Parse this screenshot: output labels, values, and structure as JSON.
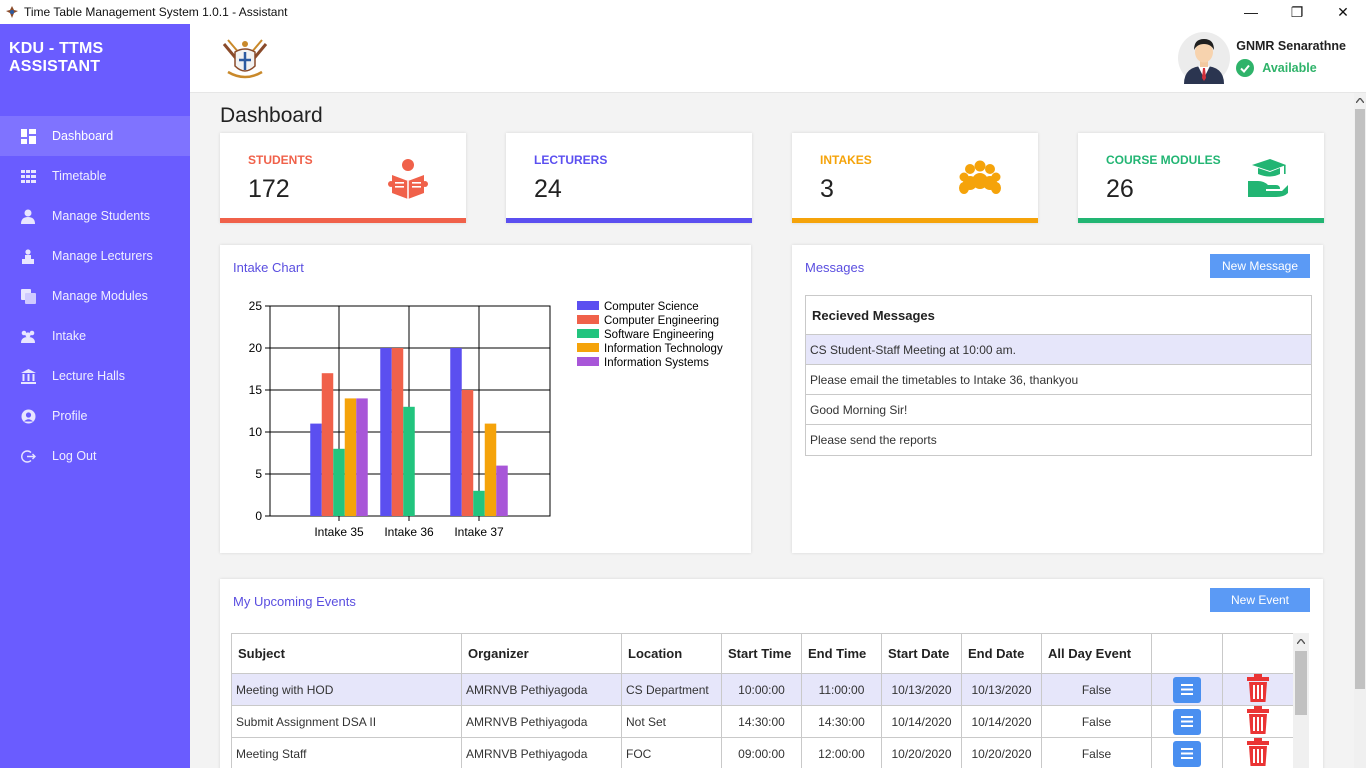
{
  "window": {
    "title": "Time Table Management System 1.0.1 - Assistant",
    "minimize": "—",
    "maximize": "❐",
    "close": "✕"
  },
  "sidebar": {
    "brand": "KDU - TTMS ASSISTANT",
    "items": [
      {
        "label": "Dashboard",
        "icon": "dashboard-icon",
        "active": true
      },
      {
        "label": "Timetable",
        "icon": "table-icon"
      },
      {
        "label": "Manage Students",
        "icon": "student-icon"
      },
      {
        "label": "Manage Lecturers",
        "icon": "lecturer-icon"
      },
      {
        "label": "Manage Modules",
        "icon": "modules-icon"
      },
      {
        "label": "Intake",
        "icon": "group-icon"
      },
      {
        "label": "Lecture Halls",
        "icon": "building-icon"
      },
      {
        "label": "Profile",
        "icon": "user-icon"
      },
      {
        "label": "Log Out",
        "icon": "logout-icon"
      }
    ]
  },
  "user": {
    "name": "GNMR Senarathne",
    "status": "Available"
  },
  "page_title": "Dashboard",
  "stats": [
    {
      "label": "STUDENTS",
      "value": "172",
      "color": "#f0614a",
      "icon": "reading-student-icon"
    },
    {
      "label": "LECTURERS",
      "value": "24",
      "color": "#5b4ff0",
      "icon": ""
    },
    {
      "label": "INTAKES",
      "value": "3",
      "color": "#f5a30a",
      "icon": "crowd-icon"
    },
    {
      "label": "COURSE MODULES",
      "value": "26",
      "color": "#22b573",
      "icon": "graduation-hand-icon"
    }
  ],
  "intake_chart_title": "Intake Chart",
  "messages": {
    "title": "Messages",
    "new_button": "New Message",
    "header": "Recieved Messages",
    "items": [
      "CS Student-Staff Meeting at 10:00 am.",
      "Please email the timetables to Intake 36, thankyou",
      "Good Morning Sir!",
      "Please send the reports"
    ]
  },
  "events": {
    "title": "My Upcoming Events",
    "new_button": "New Event",
    "columns": [
      "Subject",
      "Organizer",
      "Location",
      "Start Time",
      "End Time",
      "Start Date",
      "End Date",
      "All Day Event",
      "",
      ""
    ],
    "rows": [
      [
        "Meeting with HOD",
        "AMRNVB Pethiyagoda",
        "CS Department",
        "10:00:00",
        "11:00:00",
        "10/13/2020",
        "10/13/2020",
        "False"
      ],
      [
        "Submit Assignment DSA II",
        "AMRNVB Pethiyagoda",
        "Not Set",
        "14:30:00",
        "14:30:00",
        "10/14/2020",
        "10/14/2020",
        "False"
      ],
      [
        "Meeting Staff",
        "AMRNVB Pethiyagoda",
        "FOC",
        "09:00:00",
        "12:00:00",
        "10/20/2020",
        "10/20/2020",
        "False"
      ]
    ]
  },
  "chart_data": {
    "type": "bar",
    "title": "",
    "categories": [
      "Intake 35",
      "Intake 36",
      "Intake 37"
    ],
    "ylim": [
      0,
      25
    ],
    "yticks": [
      0,
      5,
      10,
      15,
      20,
      25
    ],
    "grid": true,
    "legend": "top-right",
    "series": [
      {
        "name": "Computer Science",
        "color": "#5b4ff0",
        "values": [
          11,
          20,
          20
        ]
      },
      {
        "name": "Computer Engineering",
        "color": "#f0614a",
        "values": [
          17,
          20,
          15
        ]
      },
      {
        "name": "Software Engineering",
        "color": "#22c47e",
        "values": [
          8,
          13,
          3
        ]
      },
      {
        "name": "Information Technology",
        "color": "#f5a30a",
        "values": [
          14,
          0,
          11
        ]
      },
      {
        "name": "Information Systems",
        "color": "#a856d8",
        "values": [
          14,
          0,
          6
        ]
      }
    ]
  }
}
